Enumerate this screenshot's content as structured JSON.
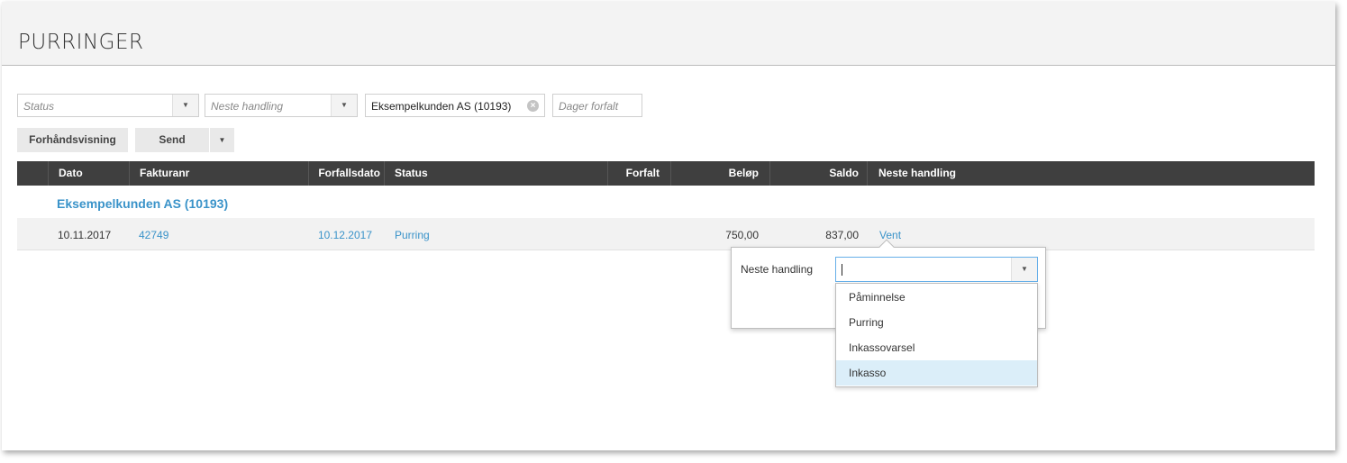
{
  "page_title": "PURRINGER",
  "filters": {
    "status_placeholder": "Status",
    "next_action_placeholder": "Neste handling",
    "customer_value": "Eksempelkunden AS (10193)",
    "days_overdue_placeholder": "Dager forfalt"
  },
  "toolbar": {
    "preview_label": "Forhåndsvisning",
    "send_label": "Send"
  },
  "table": {
    "columns": [
      "Dato",
      "Fakturanr",
      "Forfallsdato",
      "Status",
      "Forfalt",
      "Beløp",
      "Saldo",
      "Neste handling"
    ],
    "group_title": "Eksempelkunden AS (10193)",
    "row": {
      "dato": "10.11.2017",
      "fakturanr": "42749",
      "forfallsdato": "10.12.2017",
      "status": "Purring",
      "forfalt": "",
      "belop": "750,00",
      "saldo": "837,00",
      "neste_handling": "Vent"
    }
  },
  "popover": {
    "label": "Neste handling",
    "input_value": "",
    "options": [
      "Påminnelse",
      "Purring",
      "Inkassovarsel",
      "Inkasso"
    ],
    "highlighted": "Inkasso"
  },
  "colors": {
    "accent": "#3a93c9",
    "header_bg": "#3f3f3f",
    "highlight": "#dbeef9"
  }
}
